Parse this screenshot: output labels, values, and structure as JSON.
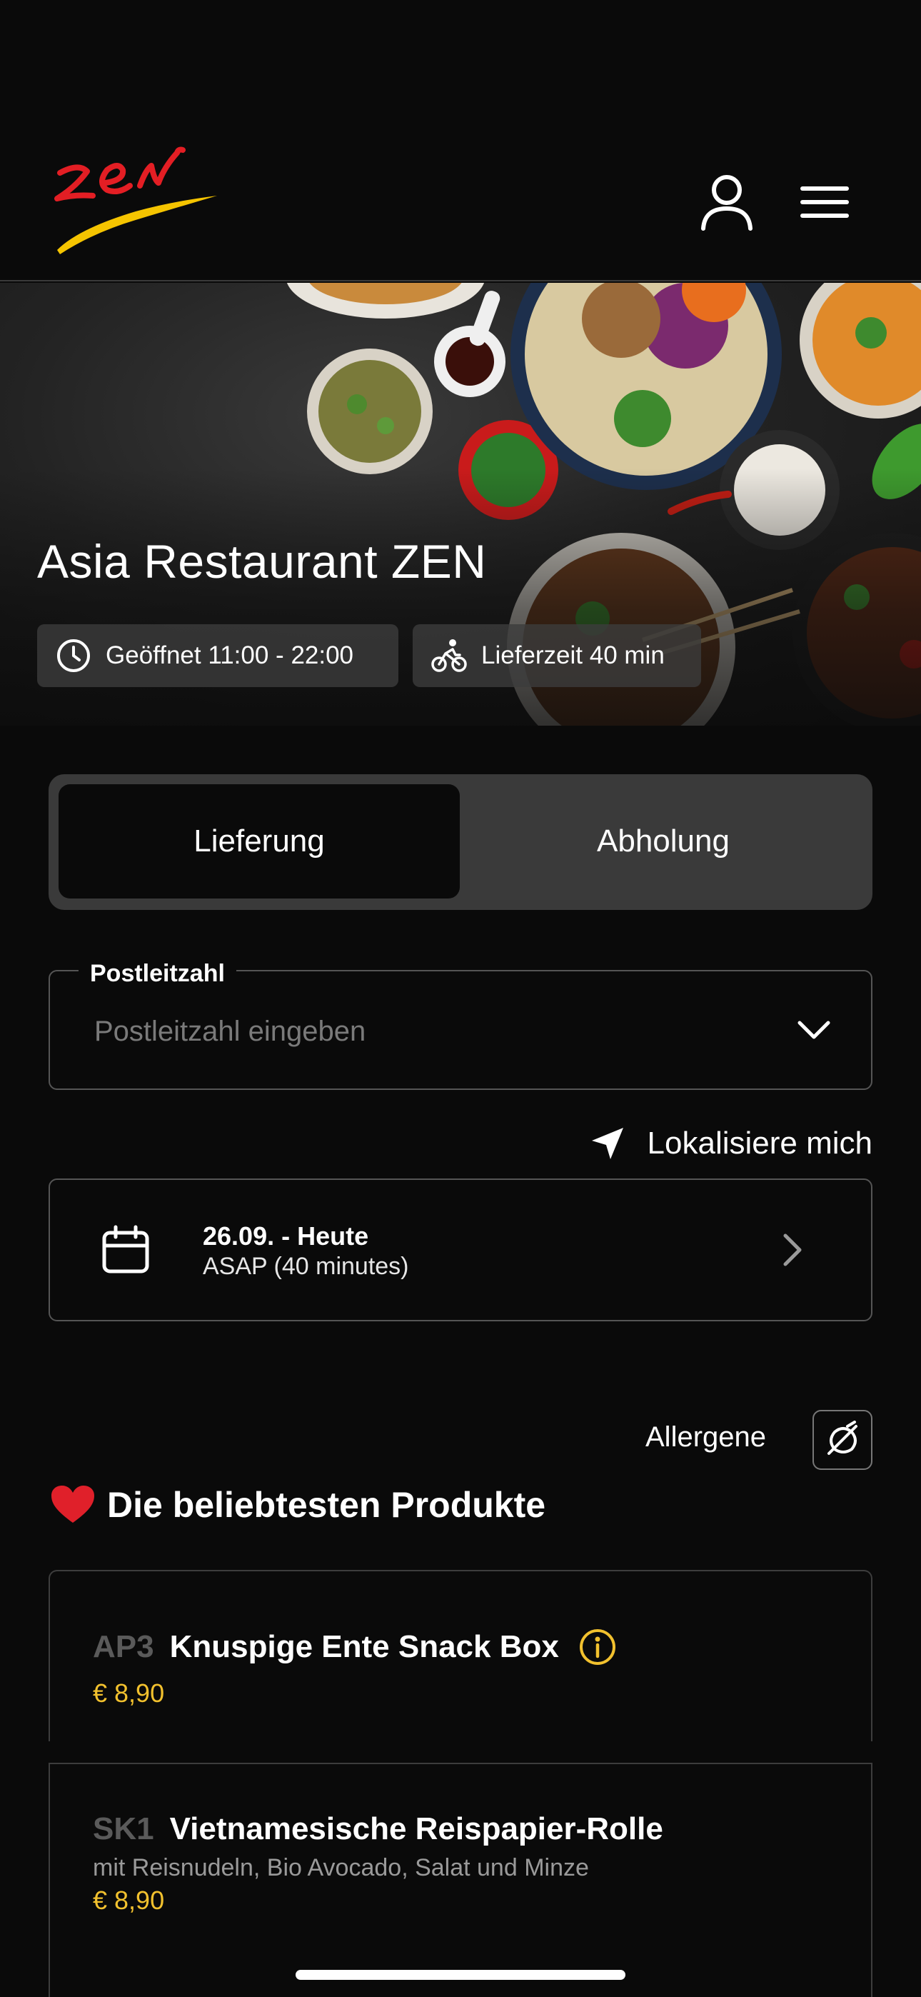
{
  "brand": {
    "logo_text": "ZEN",
    "accent_red": "#e31e24",
    "accent_yellow": "#f5c400"
  },
  "header": {
    "user_icon": "user-icon",
    "menu_icon": "menu-icon"
  },
  "hero": {
    "title": "Asia Restaurant ZEN",
    "opening_hours": "Geöffnet 11:00 - 22:00",
    "delivery_time": "Lieferzeit 40 min"
  },
  "mode_toggle": {
    "delivery": "Lieferung",
    "pickup": "Abholung",
    "selected": "Lieferung"
  },
  "postal_code": {
    "label": "Postleitzahl",
    "placeholder": "Postleitzahl eingeben",
    "value": ""
  },
  "localize": {
    "label": "Lokalisiere mich"
  },
  "schedule": {
    "date": "26.09. - Heute",
    "time": "ASAP (40 minutes)"
  },
  "allergens": {
    "label": "Allergene"
  },
  "section": {
    "emoji": "❤️",
    "title": "Die beliebtesten Produkte"
  },
  "products": [
    {
      "code": "AP3",
      "name": "Knuspige Ente Snack Box",
      "description": "",
      "price": "€ 8,90",
      "has_info": true
    },
    {
      "code": "SK1",
      "name": "Vietnamesische Reispapier-Rolle",
      "description": "mit Reisnudeln, Bio Avocado, Salat und Minze",
      "price": "€ 8,90",
      "has_info": false
    }
  ],
  "colors": {
    "background": "#0a0a0a",
    "price": "#f2c12e",
    "info_icon": "#f2c12e"
  }
}
